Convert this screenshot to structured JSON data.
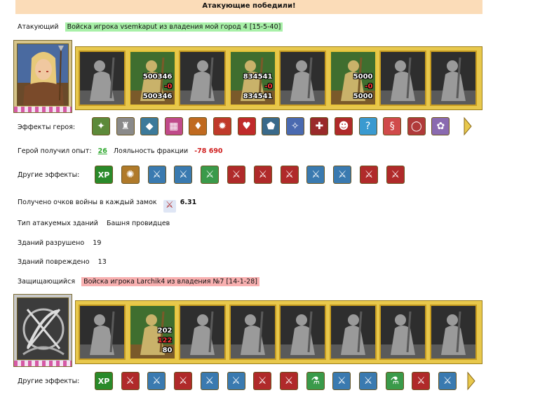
{
  "banner": "Атакующие победили!",
  "attacker": {
    "label": "Атакующий",
    "army_name": "Войска игрока vsemkaput из владения мой город 4 [15-5-40]",
    "slots": [
      {
        "top": "",
        "mid": "",
        "bot": "",
        "active": false
      },
      {
        "top": "500346",
        "mid": "-0",
        "bot": "500346",
        "active": true
      },
      {
        "top": "",
        "mid": "",
        "bot": "",
        "active": false
      },
      {
        "top": "834541",
        "mid": "-0",
        "bot": "834541",
        "active": true
      },
      {
        "top": "",
        "mid": "",
        "bot": "",
        "active": false
      },
      {
        "top": "5000",
        "mid": "-0",
        "bot": "5000",
        "active": true
      },
      {
        "top": "",
        "mid": "",
        "bot": "",
        "active": false
      },
      {
        "top": "",
        "mid": "",
        "bot": "",
        "active": false
      }
    ],
    "hero_effects_label": "Эффекты героя:",
    "hero_effects": [
      {
        "name": "scroll-icon",
        "glyph": "✦",
        "color": "#5d8a3a"
      },
      {
        "name": "armor-icon",
        "glyph": "♜",
        "color": "#8a8a8a"
      },
      {
        "name": "boots-icon",
        "glyph": "◆",
        "color": "#3c7a9a"
      },
      {
        "name": "chest-icon",
        "glyph": "▦",
        "color": "#c04a8a"
      },
      {
        "name": "treasure-icon",
        "glyph": "♦",
        "color": "#c06a20"
      },
      {
        "name": "fire-icon",
        "glyph": "✹",
        "color": "#c03a2a"
      },
      {
        "name": "heart-icon",
        "glyph": "♥",
        "color": "#c02a2a"
      },
      {
        "name": "shield-icon",
        "glyph": "⬟",
        "color": "#3a6a8a"
      },
      {
        "name": "claw-icon",
        "glyph": "✧",
        "color": "#4a6ab0"
      },
      {
        "name": "rune-icon",
        "glyph": "✚",
        "color": "#9a2a2a"
      },
      {
        "name": "mask-icon",
        "glyph": "☻",
        "color": "#b02a2a"
      },
      {
        "name": "question-icon",
        "glyph": "?",
        "color": "#3a9ad0"
      },
      {
        "name": "ribbon-icon",
        "glyph": "§",
        "color": "#d04a4a"
      },
      {
        "name": "ring-icon",
        "glyph": "◯",
        "color": "#b03a3a"
      },
      {
        "name": "flower-icon",
        "glyph": "✿",
        "color": "#8a6ab0"
      }
    ],
    "experience_label": "Герой получил опыт:",
    "experience_value": "26",
    "loyalty_label": "Лояльность фракции",
    "loyalty_value": "-78 690",
    "other_effects_label": "Другие эффекты:",
    "other_effects": [
      {
        "name": "xp-icon",
        "glyph": "XP",
        "color": "#2a8a2a"
      },
      {
        "name": "bag-icon",
        "glyph": "✺",
        "color": "#b07a2a"
      },
      {
        "name": "sword-blue-icon",
        "glyph": "⚔",
        "color": "#3a7ab0"
      },
      {
        "name": "sword-blue-icon",
        "glyph": "⚔",
        "color": "#3a7ab0"
      },
      {
        "name": "sword-green-icon",
        "glyph": "⚔",
        "color": "#3a9a4a"
      },
      {
        "name": "sword-red-icon",
        "glyph": "⚔",
        "color": "#b02a2a"
      },
      {
        "name": "sword-red-icon",
        "glyph": "⚔",
        "color": "#b02a2a"
      },
      {
        "name": "sword-red-icon",
        "glyph": "⚔",
        "color": "#b02a2a"
      },
      {
        "name": "sword-blue-icon",
        "glyph": "⚔",
        "color": "#3a7ab0"
      },
      {
        "name": "sword-blue-icon",
        "glyph": "⚔",
        "color": "#3a7ab0"
      },
      {
        "name": "sword-red-icon",
        "glyph": "⚔",
        "color": "#b02a2a"
      },
      {
        "name": "sword-red-icon",
        "glyph": "⚔",
        "color": "#b02a2a"
      }
    ],
    "war_points_label": "Получено очков войны в каждый замок",
    "war_points_value": "6.31",
    "building_type_label": "Тип атакуемых зданий",
    "building_type_value": "Башня провидцев",
    "destroyed_label": "Зданий разрушено",
    "destroyed_value": "19",
    "damaged_label": "Зданий повреждено",
    "damaged_value": "13"
  },
  "defender": {
    "label": "Защищающийся",
    "army_name": "Войска игрока Larchik4 из владения №7 [14-1-28]",
    "slots": [
      {
        "top": "",
        "mid": "",
        "bot": "",
        "active": false
      },
      {
        "top": "202",
        "mid": "122",
        "bot": "80",
        "active": true
      },
      {
        "top": "",
        "mid": "",
        "bot": "",
        "active": false
      },
      {
        "top": "",
        "mid": "",
        "bot": "",
        "active": false
      },
      {
        "top": "",
        "mid": "",
        "bot": "",
        "active": false
      },
      {
        "top": "",
        "mid": "",
        "bot": "",
        "active": false
      },
      {
        "top": "",
        "mid": "",
        "bot": "",
        "active": false
      },
      {
        "top": "",
        "mid": "",
        "bot": "",
        "active": false
      }
    ],
    "other_effects_label": "Другие эффекты:",
    "other_effects": [
      {
        "name": "xp-icon",
        "glyph": "XP",
        "color": "#2a8a2a"
      },
      {
        "name": "sword-red-icon",
        "glyph": "⚔",
        "color": "#b02a2a"
      },
      {
        "name": "sword-blue-icon",
        "glyph": "⚔",
        "color": "#3a7ab0"
      },
      {
        "name": "sword-red-icon",
        "glyph": "⚔",
        "color": "#b02a2a"
      },
      {
        "name": "sword-blue-icon",
        "glyph": "⚔",
        "color": "#3a7ab0"
      },
      {
        "name": "sword-blue-icon",
        "glyph": "⚔",
        "color": "#3a7ab0"
      },
      {
        "name": "sword-red-icon",
        "glyph": "⚔",
        "color": "#b02a2a"
      },
      {
        "name": "sword-red-icon",
        "glyph": "⚔",
        "color": "#b02a2a"
      },
      {
        "name": "potion-green-icon",
        "glyph": "⚗",
        "color": "#3a9a4a"
      },
      {
        "name": "sword-blue-icon",
        "glyph": "⚔",
        "color": "#3a7ab0"
      },
      {
        "name": "sword-blue-icon",
        "glyph": "⚔",
        "color": "#3a7ab0"
      },
      {
        "name": "potion-green-icon",
        "glyph": "⚗",
        "color": "#3a9a4a"
      },
      {
        "name": "sword-red-icon",
        "glyph": "⚔",
        "color": "#b02a2a"
      },
      {
        "name": "sword-blue-icon",
        "glyph": "⚔",
        "color": "#3a7ab0"
      }
    ]
  }
}
